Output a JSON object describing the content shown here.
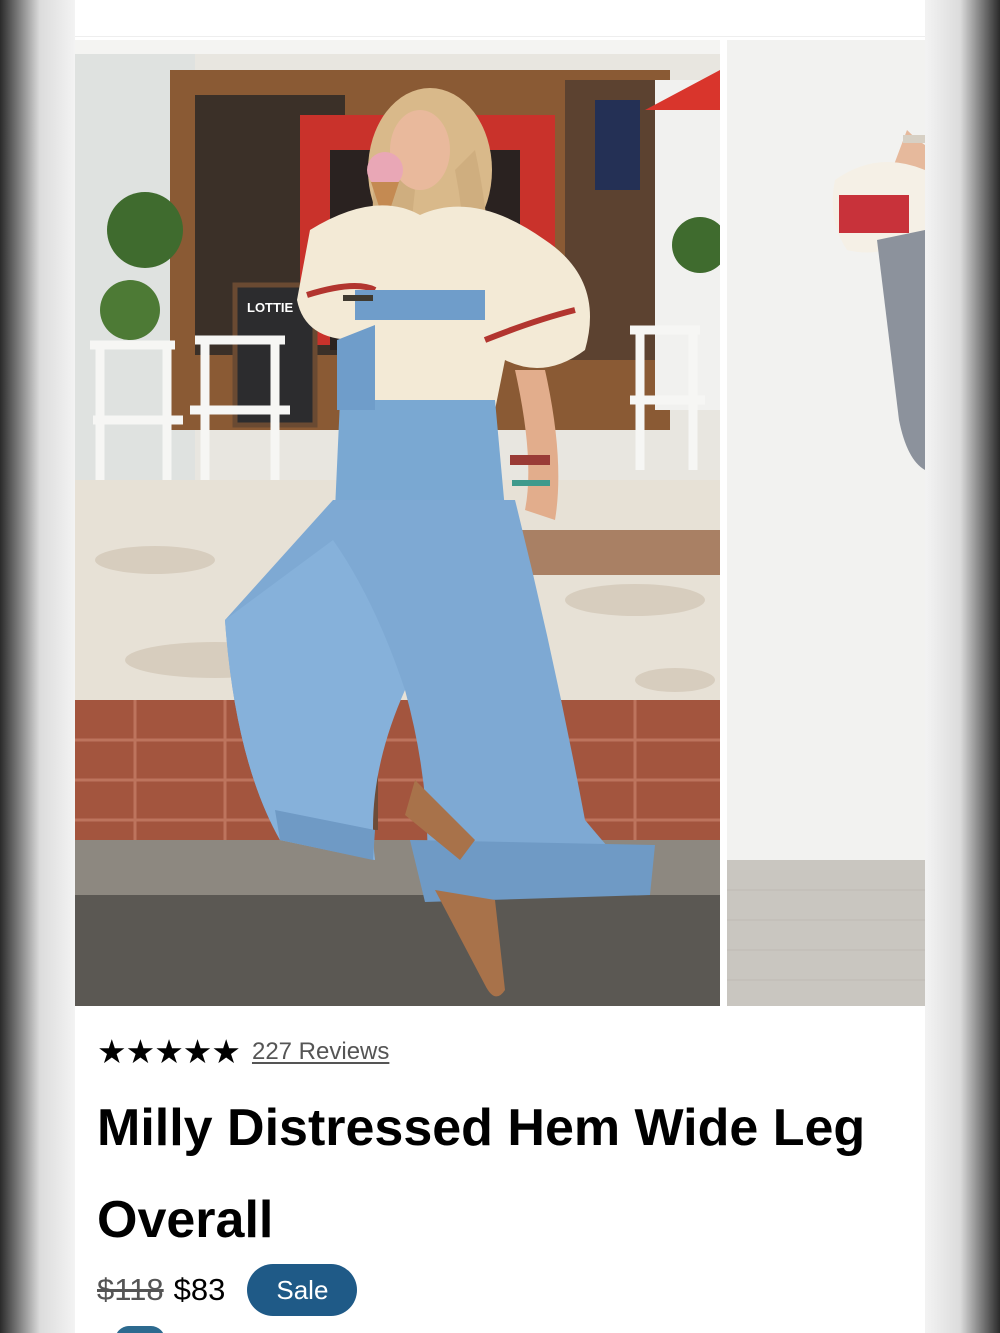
{
  "product": {
    "images": [
      {
        "alt": "Model wearing overalls eating ice cream outside a cafe"
      },
      {
        "alt": "Next product photo partially visible"
      }
    ],
    "cafe_sign": "LOTTIE",
    "rating": {
      "stars": 5,
      "star_glyph": "★",
      "reviews_label": "227 Reviews"
    },
    "title": "Milly Distressed Hem Wide Leg Overall",
    "price": {
      "original": "$118",
      "sale": "$83",
      "badge": "Sale"
    }
  },
  "colors": {
    "badge": "#1f5a87",
    "text": "#000000",
    "muted": "#555555"
  }
}
